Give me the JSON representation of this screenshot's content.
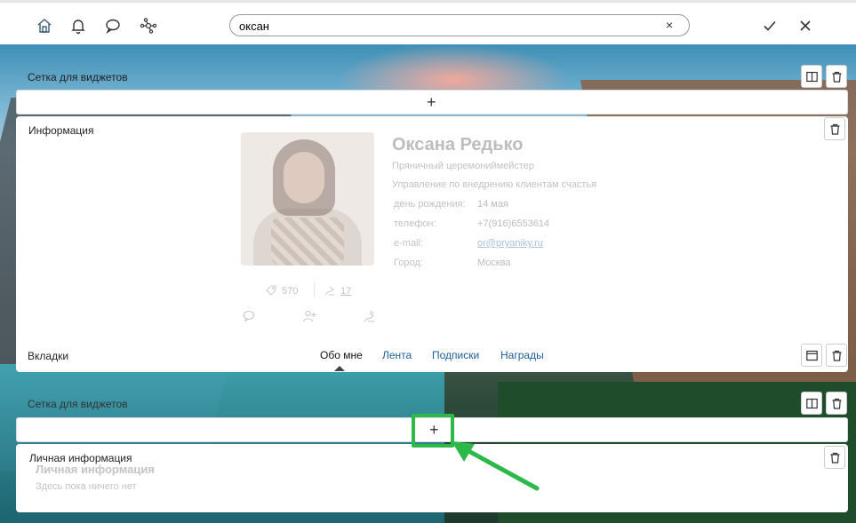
{
  "topbar": {
    "icons": [
      "home-icon",
      "bell-icon",
      "chat-icon",
      "network-icon"
    ],
    "search": {
      "value": "оксан",
      "clear": "×"
    },
    "confirm_icon": "check-icon",
    "close_icon": "close-icon"
  },
  "grid1": {
    "label": "Сетка для виджетов",
    "add": "+"
  },
  "info": {
    "label": "Информация",
    "name": "Оксана Редько",
    "position": "Пряничный церемониймейстер",
    "department": "Управление по внедрению клиентам счастья",
    "fields": [
      {
        "key": "день рождения:",
        "value": "14 мая"
      },
      {
        "key": "телефон:",
        "value": "+7(916)6553614"
      },
      {
        "key": "e-mail:",
        "value": "or@pryaniky.ru"
      },
      {
        "key": "Город:",
        "value": "Москва"
      }
    ],
    "stats": {
      "coins": "570",
      "thanks": "17"
    }
  },
  "tabs": {
    "label": "Вкладки",
    "items": [
      "Обо мне",
      "Лента",
      "Подписки",
      "Награды"
    ],
    "active": "Обо мне"
  },
  "grid2": {
    "label": "Сетка для виджетов",
    "add": "+"
  },
  "personal": {
    "label": "Личная информация",
    "title": "Личная информация",
    "empty": "Здесь пока ничего нет"
  },
  "colors": {
    "highlight": "#2db84a",
    "link": "#1d5f98"
  }
}
